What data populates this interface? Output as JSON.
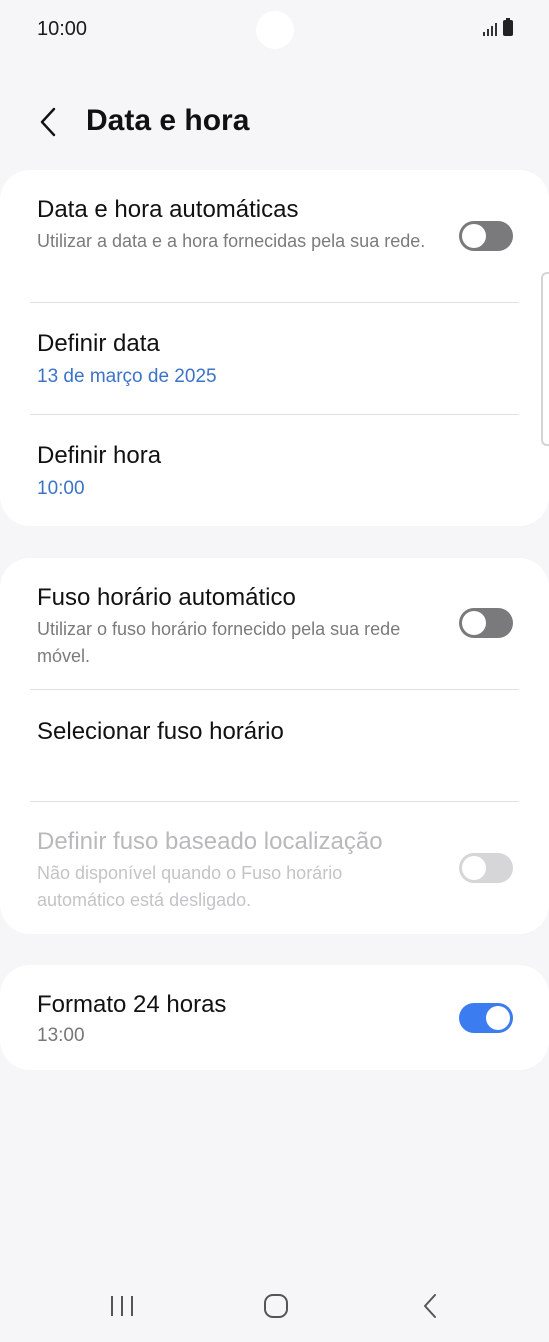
{
  "status_bar": {
    "time": "10:00"
  },
  "header": {
    "title": "Data e hora"
  },
  "card1": {
    "auto_datetime": {
      "title": "Data e hora automáticas",
      "subtitle": "Utilizar a data e a hora fornecidas pela sua rede.",
      "enabled": false
    },
    "set_date": {
      "title": "Definir data",
      "value": "13 de março de 2025"
    },
    "set_time": {
      "title": "Definir hora",
      "value": "10:00"
    }
  },
  "card2": {
    "auto_timezone": {
      "title": "Fuso horário automático",
      "subtitle": "Utilizar o fuso horário fornecido pela sua rede móvel.",
      "enabled": false
    },
    "select_timezone": {
      "title": "Selecionar fuso horário"
    },
    "location_timezone": {
      "title": "Definir fuso baseado localização",
      "subtitle": "Não disponível quando o Fuso horário automático está desligado.",
      "enabled": false
    }
  },
  "card3": {
    "format_24h": {
      "title": "Formato 24 horas",
      "value": "13:00",
      "enabled": true
    }
  },
  "colors": {
    "accent": "#3b7cf0",
    "link": "#3c73c8",
    "background": "#f6f6f8"
  },
  "icons": {
    "back": "chevron-left-icon",
    "nav_recent": "recent-apps-icon",
    "nav_home": "home-icon",
    "nav_back": "back-icon"
  }
}
